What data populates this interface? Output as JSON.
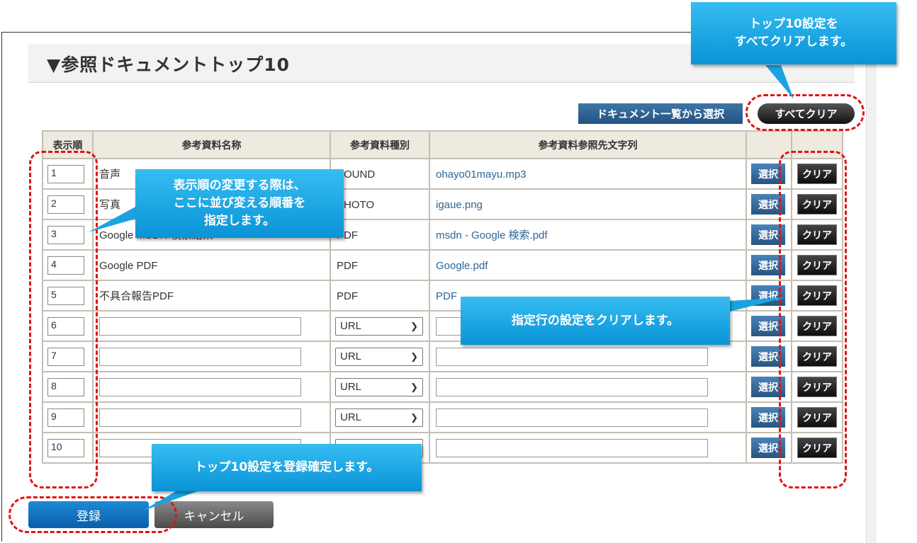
{
  "section_title": "▼参照ドキュメントトップ10",
  "toolbar": {
    "select_from_list_label": "ドキュメント一覧から選択",
    "clear_all_label": "すべてクリア"
  },
  "table": {
    "headers": [
      "表示順",
      "参考資料名称",
      "参考資料種別",
      "参考資料参照先文字列",
      "",
      ""
    ],
    "rows": [
      {
        "order": "1",
        "name": "音声",
        "type": "SOUND",
        "ref": "ohayo01mayu.mp3",
        "select": "選択",
        "clear": "クリア"
      },
      {
        "order": "2",
        "name": "写真",
        "type": "PHOTO",
        "ref": "igaue.png",
        "select": "選択",
        "clear": "クリア"
      },
      {
        "order": "3",
        "name": "Google MSDN 検索結果",
        "type": "PDF",
        "ref": "msdn - Google 検索.pdf",
        "select": "選択",
        "clear": "クリア"
      },
      {
        "order": "4",
        "name": "Google PDF",
        "type": "PDF",
        "ref": "Google.pdf",
        "select": "選択",
        "clear": "クリア"
      },
      {
        "order": "5",
        "name": "不具合報告PDF",
        "type": "PDF",
        "ref": "PDF",
        "select": "選択",
        "clear": "クリア"
      },
      {
        "order": "6",
        "name": "",
        "type": "URL",
        "ref": "",
        "select": "選択",
        "clear": "クリア"
      },
      {
        "order": "7",
        "name": "",
        "type": "URL",
        "ref": "",
        "select": "選択",
        "clear": "クリア"
      },
      {
        "order": "8",
        "name": "",
        "type": "URL",
        "ref": "",
        "select": "選択",
        "clear": "クリア"
      },
      {
        "order": "9",
        "name": "",
        "type": "URL",
        "ref": "",
        "select": "選択",
        "clear": "クリア"
      },
      {
        "order": "10",
        "name": "",
        "type": "URL",
        "ref": "",
        "select": "選択",
        "clear": "クリア"
      }
    ]
  },
  "footer": {
    "register_label": "登録",
    "cancel_label": "キャンセル"
  },
  "callouts": {
    "clear_all": "トップ10設定を\nすべてクリアします。",
    "order": "表示順の変更する際は、\nここに並び変える順番を\n指定します。",
    "row_clear": "指定行の設定をクリアします。",
    "register": "トップ10設定を登録確定します。"
  },
  "colors": {
    "callout": "#0a93d6",
    "highlight": "#e01414",
    "register": "#0a5ea8"
  }
}
